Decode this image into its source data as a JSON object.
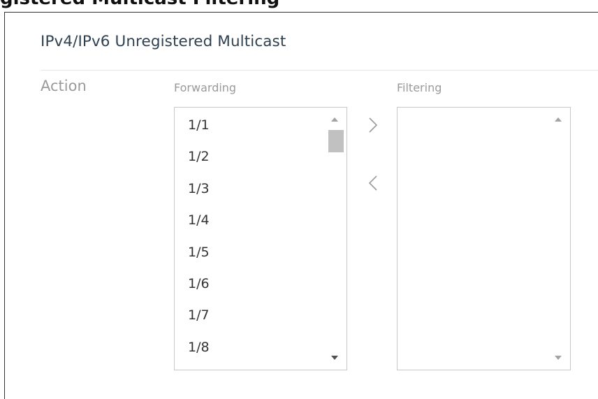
{
  "caption": "gistered Multicast Filtering",
  "section": {
    "title": "IPv4/IPv6 Unregistered Multicast"
  },
  "action": {
    "label": "Action",
    "forwarding": {
      "label": "Forwarding",
      "items": [
        "1/1",
        "1/2",
        "1/3",
        "1/4",
        "1/5",
        "1/6",
        "1/7",
        "1/8"
      ]
    },
    "filtering": {
      "label": "Filtering",
      "items": []
    },
    "move_right_icon": "chevron-right-icon",
    "move_left_icon": "chevron-left-icon"
  },
  "colors": {
    "title_text": "#2f4150",
    "muted_label": "#9a9a9a",
    "item_text": "#333333",
    "border": "#c8c8c8",
    "scroll_thumb": "#c1c1c1"
  }
}
